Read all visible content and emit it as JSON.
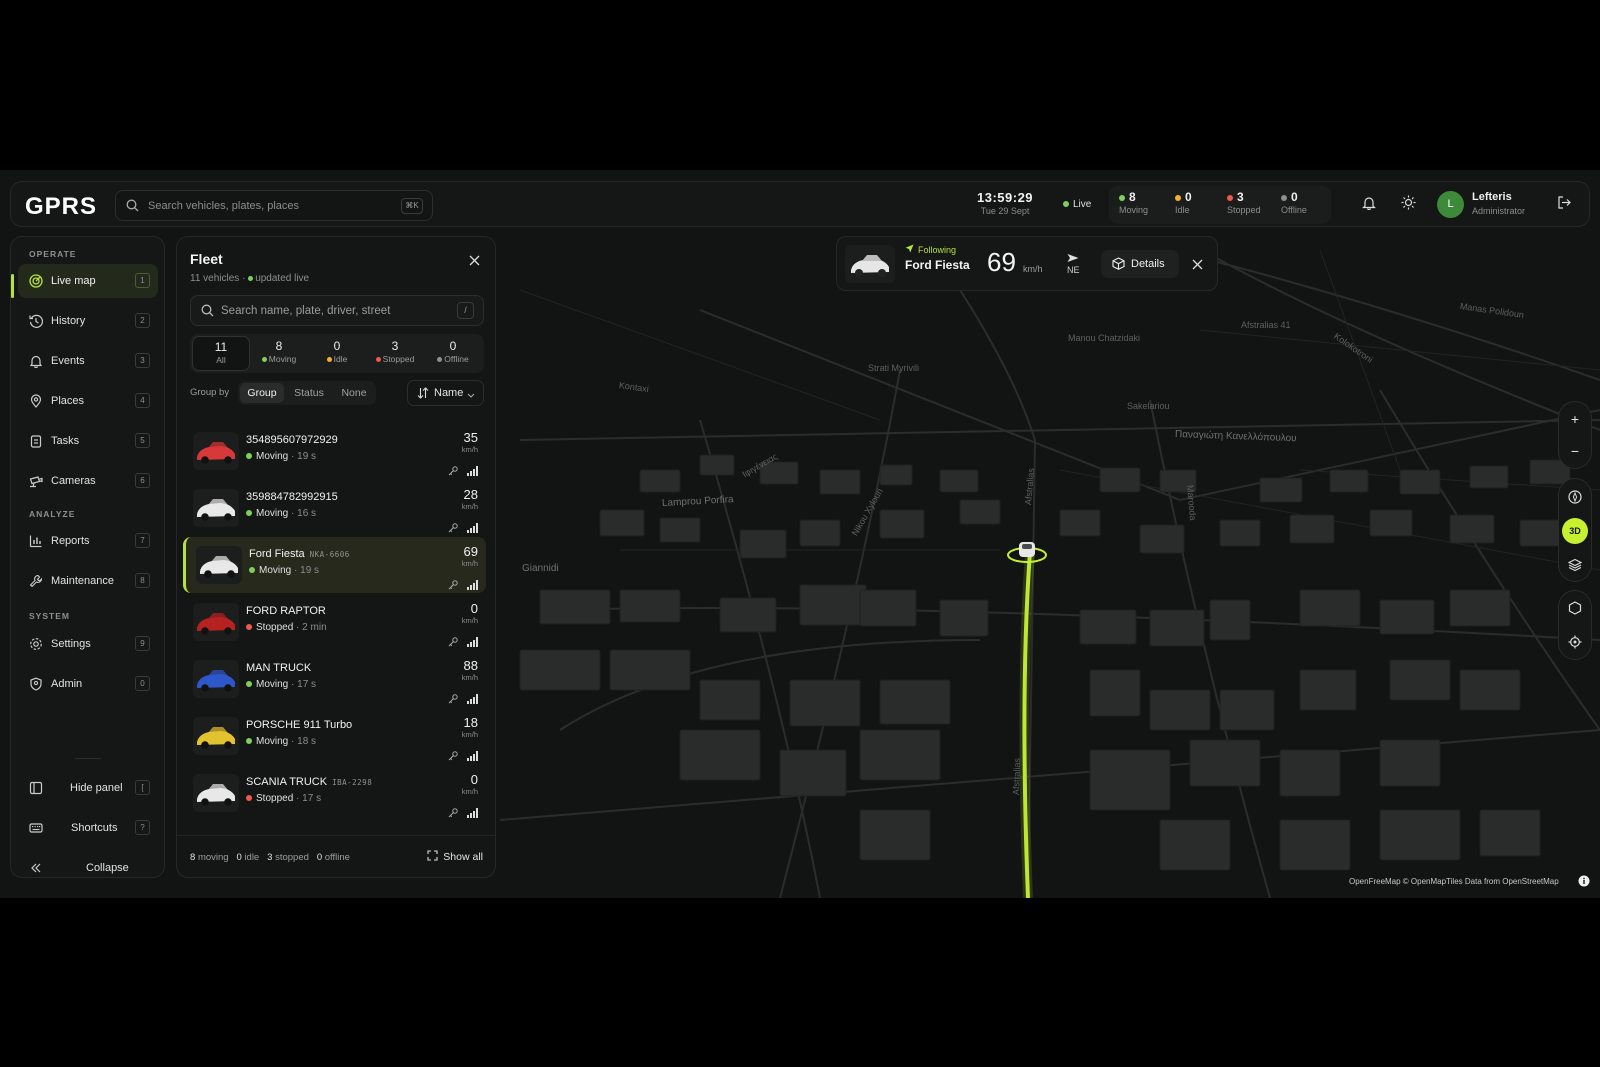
{
  "app": {
    "logo": "GPRS"
  },
  "topbar": {
    "search_placeholder": "Search vehicles, plates, places",
    "search_shortcut": "⌘K",
    "time": "13:59:29",
    "date": "Tue 29 Sept",
    "live_label": "Live",
    "stats": [
      {
        "count": "8",
        "label": "Moving",
        "color": "#7fd05a"
      },
      {
        "count": "0",
        "label": "Idle",
        "color": "#f0b429"
      },
      {
        "count": "3",
        "label": "Stopped",
        "color": "#ef5a4a"
      },
      {
        "count": "0",
        "label": "Offline",
        "color": "#8d9090"
      }
    ],
    "user": {
      "initial": "L",
      "name": "Lefteris",
      "role": "Administrator"
    }
  },
  "sidebar": {
    "sections": {
      "operate": "OPERATE",
      "analyze": "ANALYZE",
      "system": "SYSTEM"
    },
    "items": [
      {
        "label": "Live map",
        "key": "1",
        "icon": "radar-icon"
      },
      {
        "label": "History",
        "key": "2",
        "icon": "history-icon"
      },
      {
        "label": "Events",
        "key": "3",
        "icon": "bell-icon"
      },
      {
        "label": "Places",
        "key": "4",
        "icon": "pin-icon"
      },
      {
        "label": "Tasks",
        "key": "5",
        "icon": "clipboard-icon"
      },
      {
        "label": "Cameras",
        "key": "6",
        "icon": "camera-icon"
      },
      {
        "label": "Reports",
        "key": "7",
        "icon": "bar-chart-icon"
      },
      {
        "label": "Maintenance",
        "key": "8",
        "icon": "wrench-icon"
      },
      {
        "label": "Settings",
        "key": "9",
        "icon": "gear-icon"
      },
      {
        "label": "Admin",
        "key": "0",
        "icon": "shield-icon"
      }
    ],
    "bottom": [
      {
        "label": "Hide panel",
        "key": "["
      },
      {
        "label": "Shortcuts",
        "key": "?"
      },
      {
        "label": "Collapse"
      }
    ]
  },
  "fleet": {
    "title": "Fleet",
    "count_text": "11 vehicles",
    "updated_text": "updated live",
    "search_placeholder": "Search name, plate, driver, street",
    "search_shortcut": "/",
    "tabs": [
      {
        "count": "11",
        "label": "All"
      },
      {
        "count": "8",
        "label": "Moving"
      },
      {
        "count": "0",
        "label": "Idle"
      },
      {
        "count": "3",
        "label": "Stopped"
      },
      {
        "count": "0",
        "label": "Offline"
      }
    ],
    "group_by_label": "Group by",
    "group_options": [
      "Group",
      "Status",
      "None"
    ],
    "sort_label": "Name",
    "vehicles": [
      {
        "name": "354895607972929",
        "plate": "",
        "status": "Moving",
        "ago": "19 s",
        "speed": "35",
        "unit": "km/h",
        "color": "#d8383a"
      },
      {
        "name": "359884782992915",
        "plate": "",
        "status": "Moving",
        "ago": "16 s",
        "speed": "28",
        "unit": "km/h",
        "color": "#e8e8e8"
      },
      {
        "name": "Ford Fiesta",
        "plate": "NKA-6606",
        "status": "Moving",
        "ago": "19 s",
        "speed": "69",
        "unit": "km/h",
        "color": "#e8e8e8"
      },
      {
        "name": "FORD RAPTOR",
        "plate": "",
        "status": "Stopped",
        "ago": "2 min",
        "speed": "0",
        "unit": "km/h",
        "color": "#b5221f"
      },
      {
        "name": "MAN TRUCK",
        "plate": "",
        "status": "Moving",
        "ago": "17 s",
        "speed": "88",
        "unit": "km/h",
        "color": "#2e57c9"
      },
      {
        "name": "PORSCHE 911 Turbo",
        "plate": "",
        "status": "Moving",
        "ago": "18 s",
        "speed": "18",
        "unit": "km/h",
        "color": "#e3c230"
      },
      {
        "name": "SCANIA TRUCK",
        "plate": "IBA-2298",
        "status": "Stopped",
        "ago": "17 s",
        "speed": "0",
        "unit": "km/h",
        "color": "#e8e8e8"
      }
    ],
    "footer": {
      "moving": "8",
      "moving_label": "moving",
      "idle": "0",
      "idle_label": "idle",
      "stopped": "3",
      "stopped_label": "stopped",
      "offline": "0",
      "offline_label": "offline",
      "show_all": "Show all"
    }
  },
  "follow_card": {
    "tag": "Following",
    "name": "Ford Fiesta",
    "speed": "69",
    "unit": "km/h",
    "direction": "NE",
    "details_label": "Details"
  },
  "map": {
    "controls": {
      "three_d": "3D"
    },
    "labels": [
      "Lamprou Porfira",
      "Giannidi",
      "Παναγιώτη Κανελλόπουλου",
      "Afstralias",
      "Sakelariou",
      "Kontaxi",
      "Strati Myrivili",
      "Manou Chatzidaki",
      "Marooda",
      "Nikou Xylouri",
      "Afstralias 41",
      "Manas Polidoun",
      "Kolokotroni",
      "Ιφιγένειας",
      "Afstralias"
    ],
    "attribution": "OpenFreeMap © OpenMapTiles Data from OpenStreetMap"
  }
}
